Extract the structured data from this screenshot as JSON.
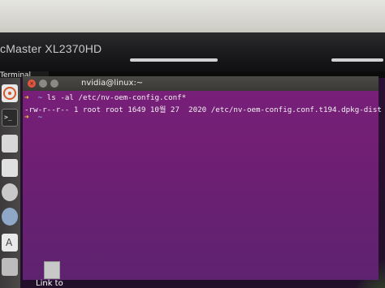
{
  "monitor": {
    "brand_text": "cMaster XL2370HD"
  },
  "top_panel": {
    "app_name": "Terminal"
  },
  "terminal": {
    "title": "nvidia@linux:~",
    "lines": [
      {
        "prompt_path": "~",
        "command": "ls -al /etc/nv-oem-config.conf*"
      },
      {
        "output": "-rw-r--r-- 1 root root 1649 10월 27  2020 /etc/nv-oem-config.conf.t194.dpkg-dist"
      },
      {
        "prompt_path": "~",
        "command": ""
      }
    ]
  },
  "desktop": {
    "file_label": "Link to"
  },
  "colors": {
    "terminal_bg": "#6e1f73",
    "prompt_arrow": "#f1d02a",
    "prompt_path": "#7ed0ff",
    "titlebar": "#3a3936",
    "close_button": "#e2553f"
  }
}
